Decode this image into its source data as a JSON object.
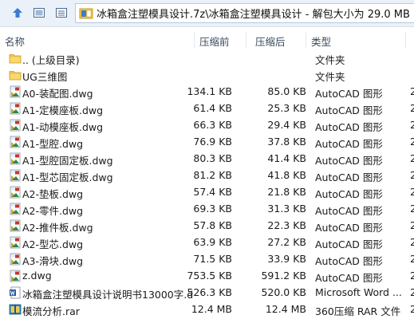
{
  "toolbar": {
    "address": "冰箱盒注塑模具设计.7z\\冰箱盒注塑模具设计 - 解包大小为 29.0 MB"
  },
  "columns": {
    "name": "名称",
    "size": "压缩前",
    "packed": "压缩后",
    "type": "类型"
  },
  "rows": [
    {
      "icon": "folder-icon",
      "name": ".. (上级目录)",
      "size": "",
      "packed": "",
      "type": "文件夹",
      "date": ""
    },
    {
      "icon": "folder-icon",
      "name": "UG三维图",
      "size": "",
      "packed": "",
      "type": "文件夹",
      "date": ""
    },
    {
      "icon": "dwg-file-icon",
      "name": "A0-装配图.dwg",
      "size": "134.1 KB",
      "packed": "85.0 KB",
      "type": "AutoCAD 图形",
      "date": "2"
    },
    {
      "icon": "dwg-file-icon",
      "name": "A1-定模座板.dwg",
      "size": "61.4 KB",
      "packed": "25.3 KB",
      "type": "AutoCAD 图形",
      "date": "2"
    },
    {
      "icon": "dwg-file-icon",
      "name": "A1-动模座板.dwg",
      "size": "66.3 KB",
      "packed": "29.4 KB",
      "type": "AutoCAD 图形",
      "date": "2"
    },
    {
      "icon": "dwg-file-icon",
      "name": "A1-型腔.dwg",
      "size": "76.9 KB",
      "packed": "37.8 KB",
      "type": "AutoCAD 图形",
      "date": "2"
    },
    {
      "icon": "dwg-file-icon",
      "name": "A1-型腔固定板.dwg",
      "size": "80.3 KB",
      "packed": "41.4 KB",
      "type": "AutoCAD 图形",
      "date": "2"
    },
    {
      "icon": "dwg-file-icon",
      "name": "A1-型芯固定板.dwg",
      "size": "81.2 KB",
      "packed": "41.8 KB",
      "type": "AutoCAD 图形",
      "date": "2"
    },
    {
      "icon": "dwg-file-icon",
      "name": "A2-垫板.dwg",
      "size": "57.4 KB",
      "packed": "21.8 KB",
      "type": "AutoCAD 图形",
      "date": "2"
    },
    {
      "icon": "dwg-file-icon",
      "name": "A2-零件.dwg",
      "size": "69.3 KB",
      "packed": "31.3 KB",
      "type": "AutoCAD 图形",
      "date": "2"
    },
    {
      "icon": "dwg-file-icon",
      "name": "A2-推件板.dwg",
      "size": "57.8 KB",
      "packed": "22.3 KB",
      "type": "AutoCAD 图形",
      "date": "2"
    },
    {
      "icon": "dwg-file-icon",
      "name": "A2-型芯.dwg",
      "size": "63.9 KB",
      "packed": "27.2 KB",
      "type": "AutoCAD 图形",
      "date": "2"
    },
    {
      "icon": "dwg-file-icon",
      "name": "A3-滑块.dwg",
      "size": "71.5 KB",
      "packed": "33.9 KB",
      "type": "AutoCAD 图形",
      "date": "2"
    },
    {
      "icon": "dwg-file-icon",
      "name": "z.dwg",
      "size": "753.5 KB",
      "packed": "591.2 KB",
      "type": "AutoCAD 图形",
      "date": "2"
    },
    {
      "icon": "word-doc-icon",
      "name": "冰箱盒注塑模具设计说明书13000字.do...",
      "size": "526.3 KB",
      "packed": "520.0 KB",
      "type": "Microsoft Word ...",
      "date": "2"
    },
    {
      "icon": "rar-archive-icon",
      "name": "模流分析.rar",
      "size": "12.4 MB",
      "packed": "12.4 MB",
      "type": "360压缩 RAR 文件",
      "date": "2"
    }
  ]
}
